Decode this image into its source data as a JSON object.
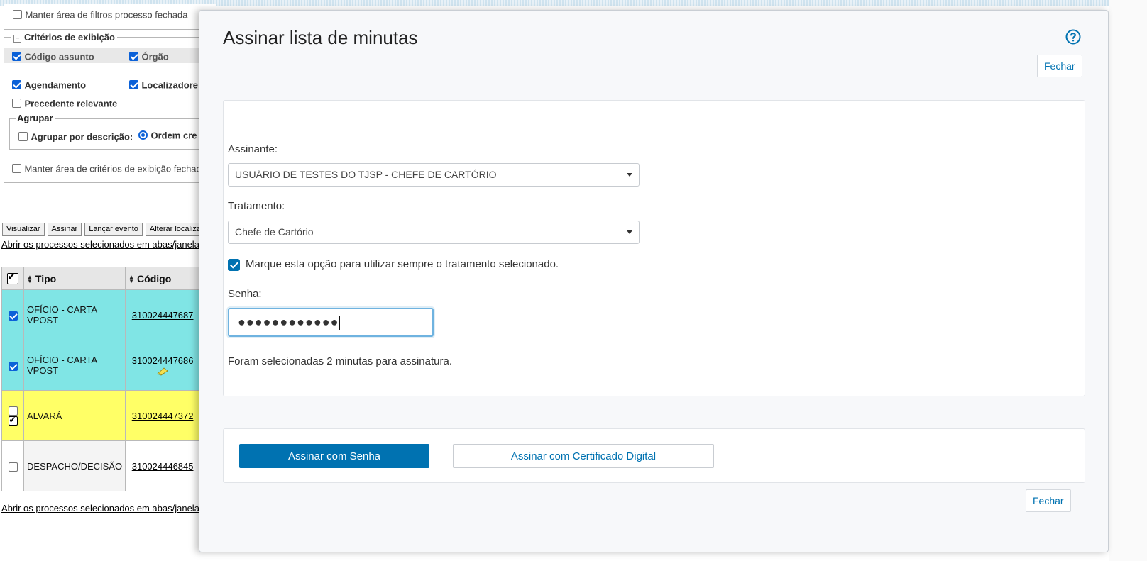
{
  "background": {
    "filter_keep_closed": "Manter área de filtros processo fechada",
    "criteria": {
      "legend": "Critérios de exibição",
      "collapse_symbol": "−",
      "items": [
        {
          "label": "Código assunto",
          "checked": true
        },
        {
          "label": "Órgão",
          "checked": true
        },
        {
          "label": "Agendamento",
          "checked": true
        },
        {
          "label": "Localizadore",
          "checked": true
        },
        {
          "label": "Precedente relevante",
          "checked": false
        }
      ],
      "group": {
        "legend": "Agrupar",
        "by_description": "Agrupar por descrição:",
        "order_label": "Ordem cre"
      },
      "keep_closed": "Manter área de critérios de exibição fechad"
    },
    "toolbar": {
      "visualizar": "Visualizar",
      "assinar": "Assinar",
      "lancar_evento": "Lançar evento",
      "alterar_localizador": "Alterar localiza"
    },
    "open_link": "Abrir os processos selecionados em abas/janelas",
    "table": {
      "headers": [
        "Tipo",
        "Código"
      ],
      "rows": [
        {
          "tipo": "OFÍCIO - CARTA VPOST",
          "codigo": "310024447687",
          "color": "cyan",
          "checked": true
        },
        {
          "tipo": "OFÍCIO - CARTA VPOST",
          "codigo": "310024447686",
          "color": "cyan",
          "checked": true
        },
        {
          "tipo": "ALVARÁ",
          "codigo": "310024447372",
          "color": "yellow",
          "checked": false
        },
        {
          "tipo": "DESPACHO/DECISÃO",
          "codigo": "310024446845",
          "color": "white",
          "checked": false
        }
      ]
    }
  },
  "modal": {
    "title": "Assinar lista de minutas",
    "help_icon": "question-circle-icon",
    "close_label": "Fechar",
    "signer": {
      "label": "Assinante:",
      "value": "USUÁRIO DE TESTES DO TJSP - CHEFE DE CARTÓRIO"
    },
    "treatment": {
      "label": "Tratamento:",
      "value": "Chefe de Cartório"
    },
    "always_use_treatment": {
      "label": "Marque esta opção para utilizar sempre o tratamento selecionado.",
      "checked": true
    },
    "password": {
      "label": "Senha:",
      "masked_value": "●●●●●●●●●●●●"
    },
    "selection_info": "Foram selecionadas 2 minutas para assinatura.",
    "actions": {
      "sign_password": "Assinar com Senha",
      "sign_certificate": "Assinar com Certificado Digital"
    },
    "colors": {
      "primary": "#0072b1",
      "row_cyan": "#80e5e5",
      "row_yellow": "#ffff66"
    }
  }
}
